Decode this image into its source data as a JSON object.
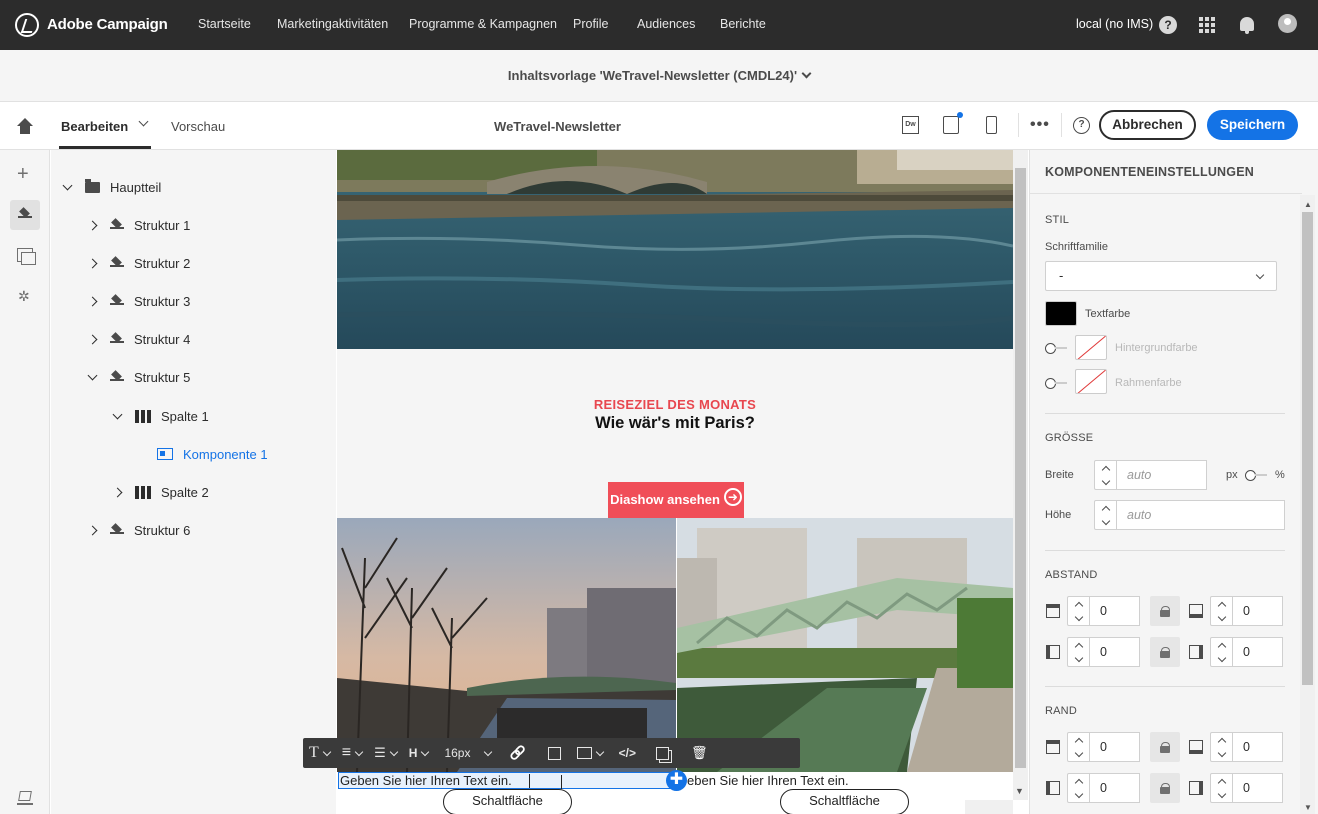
{
  "app": {
    "brand": "Adobe Campaign",
    "nav": [
      "Startseite",
      "Marketingaktivitäten",
      "Programme & Kampagnen",
      "Profile",
      "Audiences",
      "Berichte"
    ],
    "instance": "local (no IMS)",
    "help_glyph": "?"
  },
  "template": {
    "title": "Inhaltsvorlage 'WeTravel-Newsletter (CMDL24)'"
  },
  "toolbar": {
    "tab_edit": "Bearbeiten",
    "tab_preview": "Vorschau",
    "doc_name": "WeTravel-Newsletter",
    "dw_label": "Dw",
    "more_label": "•••",
    "info_glyph": "?",
    "cancel_label": "Abbrechen",
    "save_label": "Speichern"
  },
  "rail": {
    "add_glyph": "+",
    "personalization_glyph": "✲"
  },
  "tree": {
    "root": "Hauptteil",
    "items": [
      {
        "label": "Struktur 1"
      },
      {
        "label": "Struktur 2"
      },
      {
        "label": "Struktur 3"
      },
      {
        "label": "Struktur 4"
      },
      {
        "label": "Struktur 5"
      },
      {
        "label": "Spalte 1"
      },
      {
        "label": "Komponente 1"
      },
      {
        "label": "Spalte 2"
      },
      {
        "label": "Struktur 6"
      }
    ]
  },
  "email": {
    "kicker": "REISEZIEL DES MONATS",
    "headline": "Wie wär's mit Paris?",
    "slideshow_label": "Diashow ansehen",
    "slideshow_arrow": "➜",
    "text_left": "Geben Sie hier Ihren Text ein.",
    "text_right": "eben Sie hier Ihren Text ein.",
    "button_left": "Schaltfläche",
    "button_right": "Schaltfläche",
    "add_glyph": "✚"
  },
  "rte": {
    "text_glyph": "T",
    "align_glyph": "≡",
    "list_glyph": "☰",
    "heading_glyph": "H",
    "font_size": "16px",
    "link_glyph": "🔗",
    "code_glyph": "</>",
    "delete_glyph": "🗑"
  },
  "settings": {
    "title": "KOMPONENTENEINSTELLUNGEN",
    "style_section": "STIL",
    "font_family_label": "Schriftfamilie",
    "font_family_value": "-",
    "text_color_label": "Textfarbe",
    "bg_color_label": "Hintergrundfarbe",
    "border_color_label": "Rahmenfarbe",
    "size_section": "GRÖSSE",
    "width_label": "Breite",
    "width_placeholder": "auto",
    "unit_px": "px",
    "unit_pct": "%",
    "height_label": "Höhe",
    "height_placeholder": "auto",
    "spacing_section": "ABSTAND",
    "spacing": {
      "top": "0",
      "bottom": "0",
      "left": "0",
      "right": "0"
    },
    "border_section": "RAND",
    "border": {
      "top": "0",
      "bottom": "0",
      "left": "0",
      "right": "0"
    }
  },
  "colors": {
    "accent": "#1473e6",
    "topbar": "#2c2c2c",
    "promo_red": "#f04e58",
    "kicker_red": "#e8474f"
  }
}
